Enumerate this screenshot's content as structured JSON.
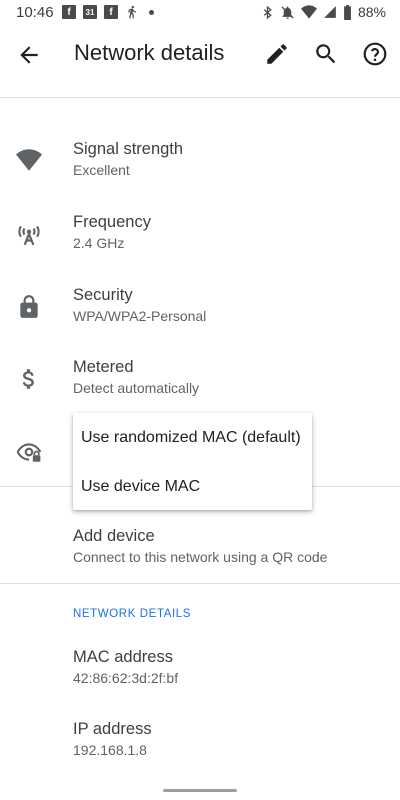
{
  "status_bar": {
    "time": "10:46",
    "left_icons": [
      "facebook-icon",
      "calendar-icon",
      "facebook-icon",
      "fitness-icon",
      "dot-icon"
    ],
    "calendar_day": "31",
    "fb_glyph": "f",
    "battery_text": "88%",
    "right_icons": [
      "bluetooth-icon",
      "do-not-disturb-icon",
      "wifi-icon",
      "signal-icon",
      "battery-icon"
    ]
  },
  "app_bar": {
    "title": "Network details",
    "actions": [
      "edit-icon",
      "search-icon",
      "help-icon"
    ]
  },
  "rows": {
    "signal": {
      "title": "Signal strength",
      "subtitle": "Excellent"
    },
    "frequency": {
      "title": "Frequency",
      "subtitle": "2.4 GHz"
    },
    "security": {
      "title": "Security",
      "subtitle": "WPA/WPA2-Personal"
    },
    "metered": {
      "title": "Metered",
      "subtitle": "Detect automatically"
    },
    "add_device": {
      "title": "Add device",
      "subtitle": "Connect to this network using a QR code"
    },
    "mac": {
      "title": "MAC address",
      "subtitle": "42:86:62:3d:2f:bf"
    },
    "ip": {
      "title": "IP address",
      "subtitle": "192.168.1.8"
    }
  },
  "section_header": "NETWORK DETAILS",
  "privacy_menu": {
    "options": [
      "Use randomized MAC (default)",
      "Use device MAC"
    ]
  },
  "colors": {
    "accent": "#1a73e8",
    "icon": "#5f6368",
    "text_primary": "#202124"
  }
}
